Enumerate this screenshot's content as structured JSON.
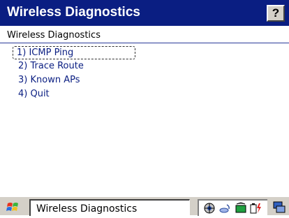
{
  "window": {
    "title": "Wireless Diagnostics",
    "help_label": "?"
  },
  "main": {
    "header": "Wireless Diagnostics",
    "menu": [
      {
        "label": "1) ICMP Ping",
        "focused": true
      },
      {
        "label": "2) Trace Route",
        "focused": false
      },
      {
        "label": "3) Known APs",
        "focused": false
      },
      {
        "label": "4) Quit",
        "focused": false
      }
    ]
  },
  "taskbar": {
    "task_label": "Wireless Diagnostics",
    "icons": [
      "start-icon",
      "network-icon",
      "wifi-icon",
      "sync-icon",
      "battery-icon",
      "desktop-icon"
    ]
  },
  "colors": {
    "titlebar": "#0a1e82",
    "menu_text": "#0a1e82",
    "taskbar": "#d4d0c8"
  }
}
